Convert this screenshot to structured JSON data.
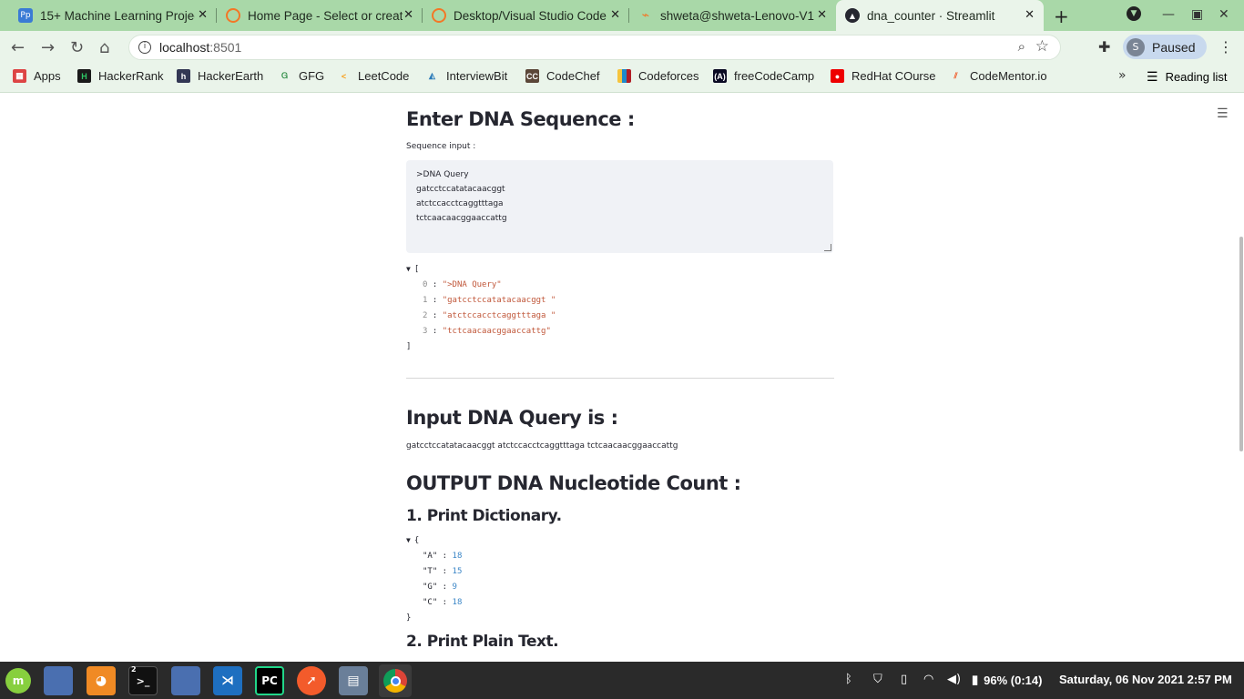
{
  "browser": {
    "tabs": [
      {
        "title": "15+ Machine Learning Projec",
        "icon": "pp-icon"
      },
      {
        "title": "Home Page - Select or creat",
        "icon": "jupyter-icon"
      },
      {
        "title": "Desktop/Visual Studio Code",
        "icon": "jupyter-icon"
      },
      {
        "title": "shweta@shweta-Lenovo-V1",
        "icon": "jupyter-terminal-icon"
      },
      {
        "title": "dna_counter · Streamlit",
        "icon": "streamlit-icon"
      }
    ],
    "url_host": "localhost",
    "url_port": ":8501",
    "profile_initial": "S",
    "profile_status": "Paused",
    "bookmarks": [
      "Apps",
      "HackerRank",
      "HackerEarth",
      "GFG",
      "LeetCode",
      "InterviewBit",
      "CodeChef",
      "Codeforces",
      "freeCodeCamp",
      "RedHat COurse",
      "CodeMentor.io"
    ],
    "reading_list": "Reading list"
  },
  "app": {
    "heading_enter": "Enter DNA Sequence :",
    "input_label": "Sequence input :",
    "textarea_lines": [
      ">DNA Query",
      "gatcctccatatacaacggt",
      "atctccacctcaggtttaga",
      "tctcaacaacggaaccattg"
    ],
    "list_open": "[",
    "list_close": "]",
    "list_items": [
      {
        "idx": "0",
        "val": "\">DNA Query\""
      },
      {
        "idx": "1",
        "val": "\"gatcctccatatacaacggt \""
      },
      {
        "idx": "2",
        "val": "\"atctccacctcaggtttaga \""
      },
      {
        "idx": "3",
        "val": "\"tctcaacaacggaaccattg\""
      }
    ],
    "heading_query": "Input DNA Query is :",
    "query_text": "gatcctccatatacaacggt atctccacctcaggtttaga tctcaacaacggaaccattg",
    "heading_output": "OUTPUT DNA Nucleotide Count :",
    "heading_dict": "1. Print Dictionary.",
    "dict_open": "{",
    "dict_close": "}",
    "dict_items": [
      {
        "key": "\"A\"",
        "val": "18"
      },
      {
        "key": "\"T\"",
        "val": "15"
      },
      {
        "key": "\"G\"",
        "val": "9"
      },
      {
        "key": "\"C\"",
        "val": "18"
      }
    ],
    "heading_plain": "2. Print Plain Text."
  },
  "taskbar": {
    "terminal_badge": "2",
    "battery": "96% (0:14)",
    "datetime": "Saturday, 06 Nov 2021  2:57 PM"
  }
}
